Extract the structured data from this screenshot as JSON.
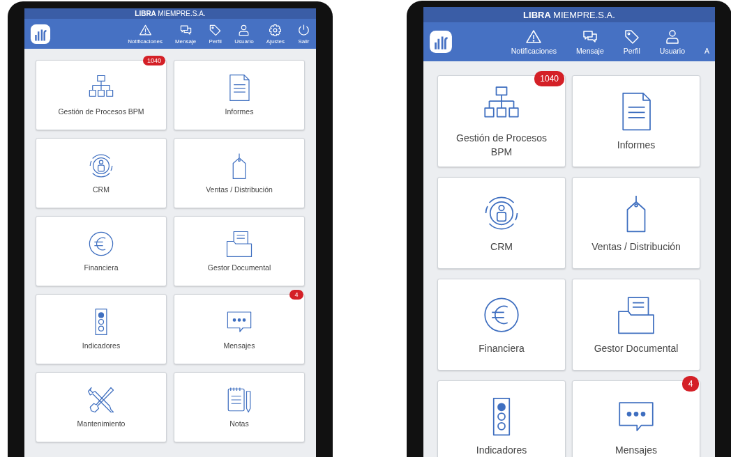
{
  "phones": [
    {
      "title_bold": "LIBRA",
      "title_rest": "MIEMPRE.S.A.",
      "nav": [
        {
          "kind": "warning",
          "label": "Notificaciones"
        },
        {
          "kind": "chat",
          "label": "Mensaje"
        },
        {
          "kind": "tag",
          "label": "Perfil"
        },
        {
          "kind": "user",
          "label": "Usuario"
        },
        {
          "kind": "gear",
          "label": "Ajustes"
        },
        {
          "kind": "power",
          "label": "Salir"
        }
      ],
      "tiles": [
        {
          "kind": "hierarchy",
          "label": "Gestión de Procesos BPM",
          "badge": "1040"
        },
        {
          "kind": "document",
          "label": "Informes"
        },
        {
          "kind": "crm",
          "label": "CRM"
        },
        {
          "kind": "tag",
          "label": "Ventas / Distribución"
        },
        {
          "kind": "euro",
          "label": "Financiera"
        },
        {
          "kind": "folder",
          "label": "Gestor Documental"
        },
        {
          "kind": "traffic",
          "label": "Indicadores"
        },
        {
          "kind": "chat",
          "label": "Mensajes",
          "badge": "4"
        },
        {
          "kind": "tools",
          "label": "Mantenimiento"
        },
        {
          "kind": "notes",
          "label": "Notas"
        }
      ]
    },
    {
      "title_bold": "LIBRA",
      "title_rest": "MIEMPRE.S.A.",
      "nav": [
        {
          "kind": "warning",
          "label": "Notificaciones"
        },
        {
          "kind": "chat",
          "label": "Mensaje"
        },
        {
          "kind": "tag",
          "label": "Perfil"
        },
        {
          "kind": "user",
          "label": "Usuario"
        },
        {
          "kind": "cut",
          "label": "A"
        }
      ],
      "tiles": [
        {
          "kind": "hierarchy",
          "label": "Gestión de Procesos BPM",
          "badge": "1040"
        },
        {
          "kind": "document",
          "label": "Informes"
        },
        {
          "kind": "crm",
          "label": "CRM"
        },
        {
          "kind": "tag",
          "label": "Ventas / Distribución"
        },
        {
          "kind": "euro",
          "label": "Financiera"
        },
        {
          "kind": "folder",
          "label": "Gestor Documental"
        },
        {
          "kind": "traffic",
          "label": "Indicadores"
        },
        {
          "kind": "chat",
          "label": "Mensajes",
          "badge": "4"
        }
      ]
    }
  ]
}
